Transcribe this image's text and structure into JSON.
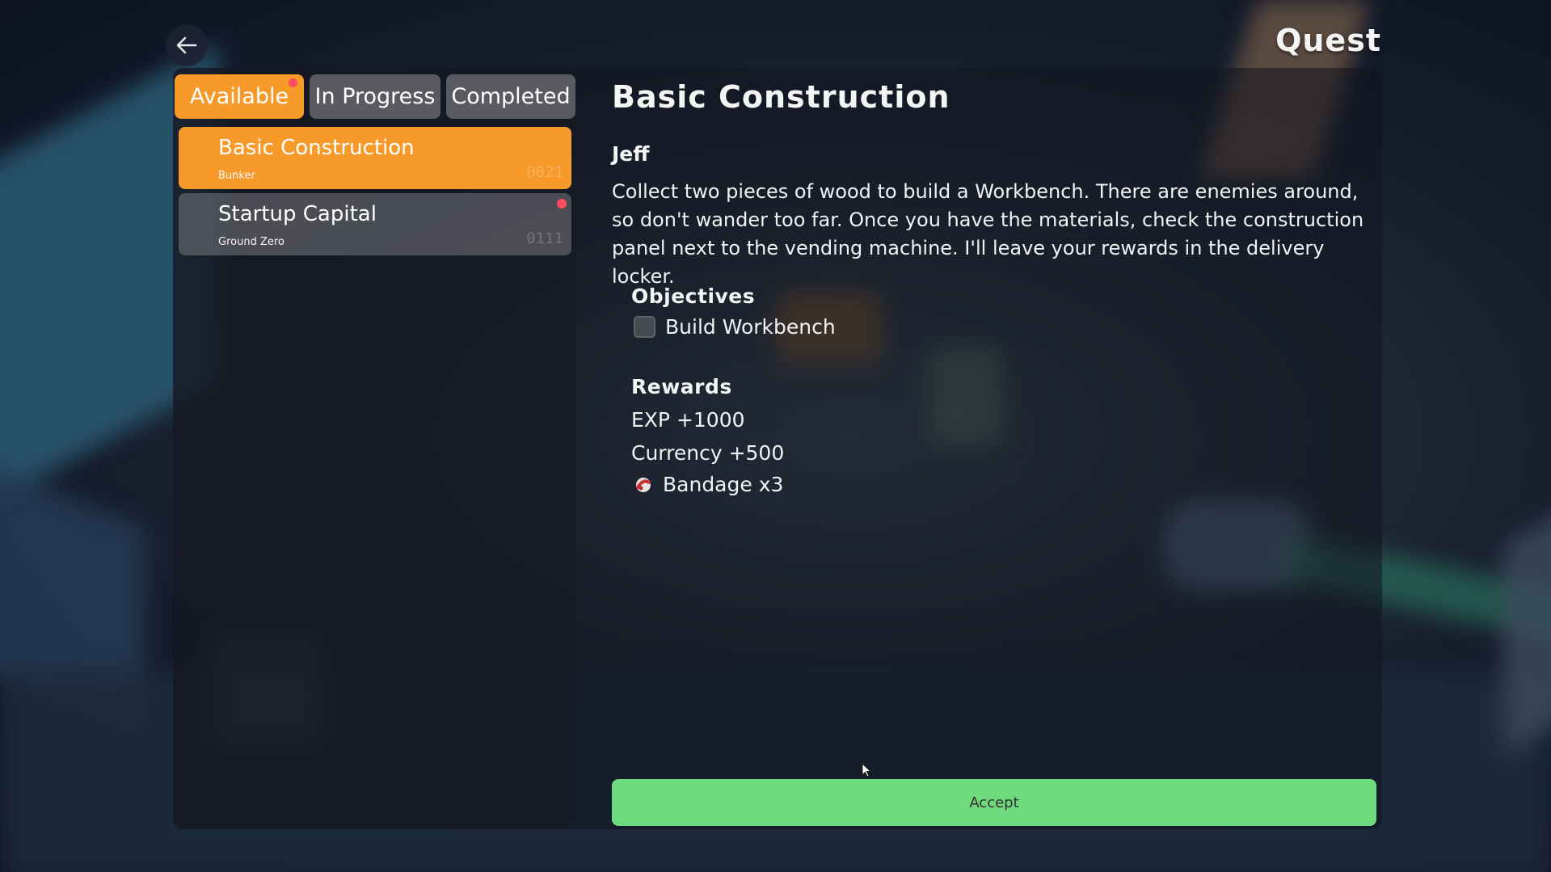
{
  "header": {
    "title": "Quest",
    "back_icon": "arrow-left-icon"
  },
  "tabs": [
    {
      "label": "Available",
      "active": true,
      "has_notification": true
    },
    {
      "label": "In Progress",
      "active": false,
      "has_notification": false
    },
    {
      "label": "Completed",
      "active": false,
      "has_notification": false
    }
  ],
  "quests": [
    {
      "name": "Basic Construction",
      "location": "Bunker",
      "code": "0021",
      "selected": true,
      "has_notification": false
    },
    {
      "name": "Startup Capital",
      "location": "Ground Zero",
      "code": "0111",
      "selected": false,
      "has_notification": true
    }
  ],
  "detail": {
    "title": "Basic Construction",
    "giver": "Jeff",
    "description": "Collect two pieces of wood to build a Workbench. There are enemies around, so don't wander too far. Once you have the materials, check the construction panel next to the vending machine. I'll leave your rewards in the delivery locker.",
    "objectives_label": "Objectives",
    "objectives": [
      {
        "text": "Build Workbench",
        "done": false
      }
    ],
    "rewards_label": "Rewards",
    "rewards": [
      {
        "text": "EXP +1000"
      },
      {
        "text": "Currency +500"
      },
      {
        "text": "Bandage x3",
        "icon": "bandage-icon"
      }
    ]
  },
  "actions": {
    "accept_label": "Accept"
  },
  "colors": {
    "accent_orange": "#f79a2a",
    "accept_green": "#6fda7d",
    "notification_red": "#ff4d5e",
    "tab_inactive": "#5a5b60"
  }
}
